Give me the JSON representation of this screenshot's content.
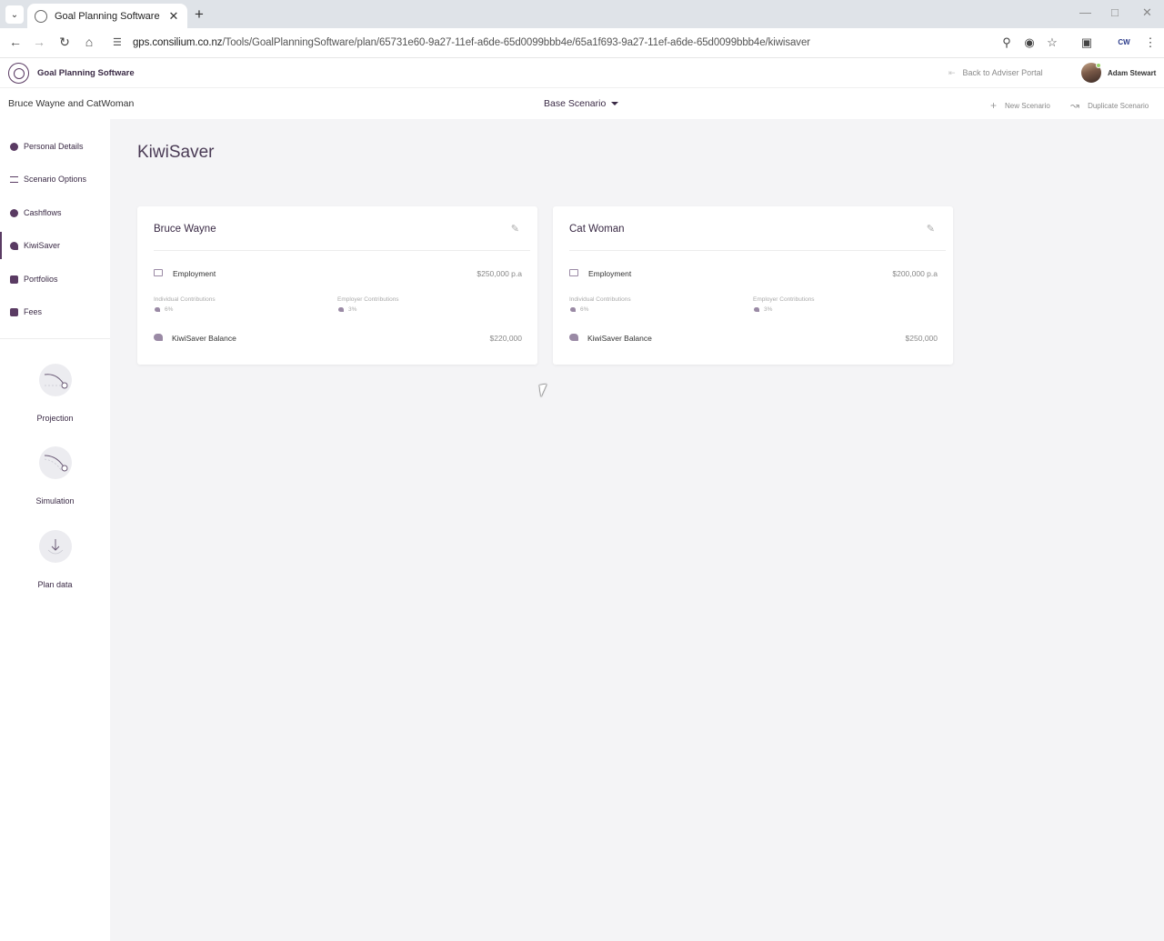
{
  "browser": {
    "tab_title": "Goal Planning Software",
    "url_host": "gps.consilium.co.nz",
    "url_path": "/Tools/GoalPlanningSoftware/plan/65731e60-9a27-11ef-a6de-65d0099bbb4e/65a1f693-9a27-11ef-a6de-65d0099bbb4e/kiwisaver",
    "extension_label": "CW"
  },
  "app": {
    "title": "Goal Planning Software",
    "back_link": "Back to Adviser Portal",
    "user_name": "Adam Stewart"
  },
  "sub_header": {
    "client": "Bruce Wayne and CatWoman",
    "scenario": "Base Scenario",
    "new_scenario": "New Scenario",
    "duplicate_scenario": "Duplicate Scenario"
  },
  "sidebar": {
    "items": [
      {
        "label": "Personal Details"
      },
      {
        "label": "Scenario Options"
      },
      {
        "label": "Cashflows"
      },
      {
        "label": "KiwiSaver"
      },
      {
        "label": "Portfolios"
      },
      {
        "label": "Fees"
      }
    ],
    "active": "KiwiSaver",
    "tools": [
      {
        "label": "Projection"
      },
      {
        "label": "Simulation"
      },
      {
        "label": "Plan data"
      }
    ]
  },
  "main": {
    "title": "KiwiSaver",
    "cards": [
      {
        "name": "Bruce Wayne",
        "employment_label": "Employment",
        "employment_value": "$250,000 p.a",
        "individual_label": "Individual Contributions",
        "individual_value": "6%",
        "employer_label": "Employer Contributions",
        "employer_value": "3%",
        "balance_label": "KiwiSaver Balance",
        "balance_value": "$220,000"
      },
      {
        "name": "Cat Woman",
        "employment_label": "Employment",
        "employment_value": "$200,000 p.a",
        "individual_label": "Individual Contributions",
        "individual_value": "6%",
        "employer_label": "Employer Contributions",
        "employer_value": "3%",
        "balance_label": "KiwiSaver Balance",
        "balance_value": "$250,000"
      }
    ]
  },
  "colors": {
    "brand": "#5a3b63",
    "main_bg": "#f4f4f6"
  }
}
